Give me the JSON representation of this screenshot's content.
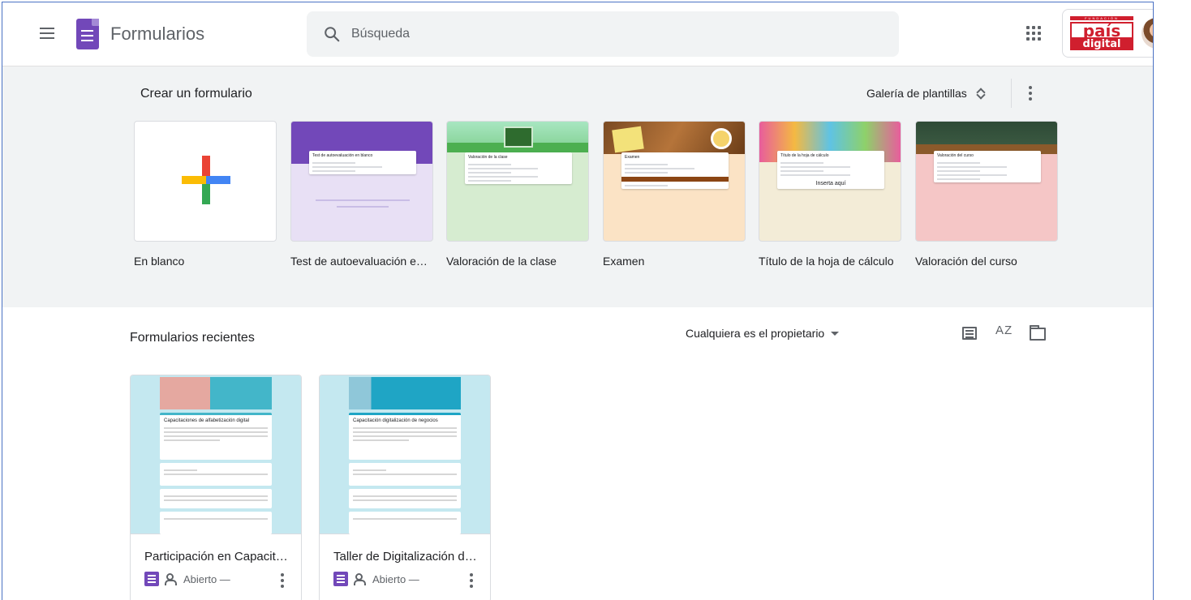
{
  "header": {
    "app_title": "Formularios",
    "search_placeholder": "Búsqueda",
    "brand": {
      "top": "FUNDACIÓN",
      "line1": "país",
      "line2": "digital"
    }
  },
  "templates": {
    "title": "Crear un formulario",
    "gallery_label": "Galería de plantillas",
    "items": [
      {
        "label": "En blanco"
      },
      {
        "label": "Test de autoevaluación en blanco",
        "preview_title": "Test de autoevaluación en blanco",
        "accent": "#7248b9",
        "bg": "#e8e0f5"
      },
      {
        "label": "Valoración de la clase",
        "preview_title": "Valoración de la clase",
        "accent": "#4caf50",
        "bg": "#d6ecd0"
      },
      {
        "label": "Examen",
        "preview_title": "Examen",
        "accent": "#e68a00",
        "bg": "#fbe3c5"
      },
      {
        "label": "Título de la hoja de cálculo",
        "preview_title": "Título de la hoja de cálculo",
        "extra": "Inserta aquí",
        "accent": "#c0a16b",
        "bg": "#f3ecd7"
      },
      {
        "label": "Valoración del curso",
        "preview_title": "Valoración del curso",
        "accent": "#d9534f",
        "bg": "#f5c6c6"
      }
    ]
  },
  "recent": {
    "title": "Formularios recientes",
    "owner_filter": "Cualquiera es el propietario",
    "sort_label": "AZ",
    "docs": [
      {
        "title": "Participación en Capacitaciones de alfabetización digital",
        "preview_title": "Capacitaciones de alfabetización digital",
        "status": "Abierto —"
      },
      {
        "title": "Taller de Digitalización de negocios",
        "preview_title": "Capacitación digitalización de negocios",
        "status": "Abierto —"
      }
    ]
  },
  "colors": {
    "accent": "#7248b9",
    "template_bg": "#f1f3f4",
    "preview_bg": "#c4e8f0"
  }
}
